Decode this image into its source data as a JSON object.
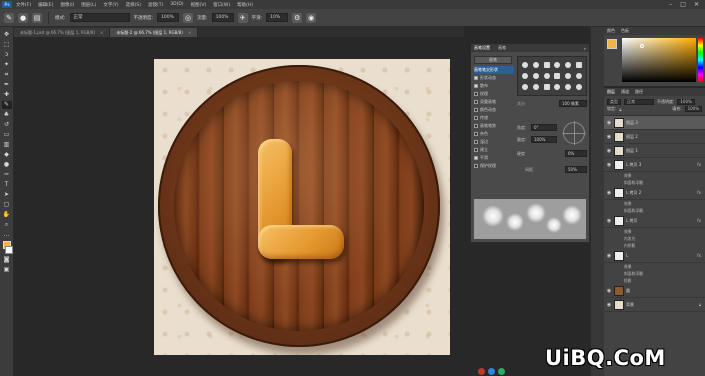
{
  "menubar": {
    "logo": "Ps",
    "items": [
      "文件(F)",
      "编辑(E)",
      "图像(I)",
      "图层(L)",
      "文字(Y)",
      "选择(S)",
      "滤镜(T)",
      "3D(D)",
      "视图(V)",
      "窗口(W)",
      "帮助(H)"
    ],
    "window_buttons": [
      "–",
      "□",
      "✕"
    ]
  },
  "options": {
    "mode_label": "模式:",
    "mode_value": "正常",
    "opacity_label": "不透明度:",
    "opacity_value": "100%",
    "flow_label": "流量:",
    "flow_value": "100%",
    "smooth_label": "平滑:",
    "smooth_value": "10%"
  },
  "tabs": [
    {
      "label": "未标题-1.psd @ 66.7% (图层 1, RGB/8)",
      "close": "×"
    },
    {
      "label": "未标题-2 @ 66.7% (图层 1, RGB/8)",
      "close": "×"
    }
  ],
  "brush_panel": {
    "tab1": "画笔设置",
    "tab2": "画笔",
    "close": "»",
    "presets_button": "画笔",
    "options": [
      {
        "label": "画笔笔尖形状",
        "on": false
      },
      {
        "label": "形状动态",
        "on": true
      },
      {
        "label": "散布",
        "on": true
      },
      {
        "label": "纹理",
        "on": false
      },
      {
        "label": "双重画笔",
        "on": false
      },
      {
        "label": "颜色动态",
        "on": false
      },
      {
        "label": "传递",
        "on": false
      },
      {
        "label": "画笔笔势",
        "on": false
      },
      {
        "label": "杂色",
        "on": false
      },
      {
        "label": "湿边",
        "on": false
      },
      {
        "label": "建立",
        "on": false
      },
      {
        "label": "平滑",
        "on": true
      },
      {
        "label": "保护纹理",
        "on": false
      }
    ],
    "size_label": "大小",
    "size_value": "100 像素",
    "angle_label": "角度:",
    "angle_value": "0°",
    "roundness_label": "圆度:",
    "roundness_value": "100%",
    "hardness_label": "硬度",
    "hardness_value": "0%",
    "spacing_label": "间距",
    "spacing_value": "50%"
  },
  "color_panel": {
    "tab1": "颜色",
    "tab2": "色板",
    "fg_color": "#f0b449",
    "bg_color": "#ffffff"
  },
  "layers_panel": {
    "tab1": "图层",
    "tab2": "通道",
    "tab3": "路径",
    "filter_label": "类型",
    "blend_mode": "正常",
    "opacity_label": "不透明度:",
    "opacity_value": "100%",
    "lock_label": "锁定:",
    "fill_label": "填充:",
    "fill_value": "100%",
    "layers": [
      {
        "name": "图层 3",
        "selected": true
      },
      {
        "name": "图层 2",
        "selected": false
      },
      {
        "name": "图层 1",
        "selected": false
      },
      {
        "name": "L 拷贝 3",
        "selected": false,
        "fx": "fx",
        "effects": [
          "效果",
          "斜面和浮雕"
        ]
      },
      {
        "name": "L 拷贝 2",
        "selected": false,
        "fx": "fx",
        "effects": [
          "效果",
          "斜面和浮雕"
        ]
      },
      {
        "name": "L 拷贝",
        "selected": false,
        "fx": "fx",
        "effects": [
          "效果",
          "内发光",
          "内阴影"
        ]
      },
      {
        "name": "L",
        "selected": false,
        "fx": "fx",
        "effects": [
          "效果",
          "斜面和浮雕",
          "投影"
        ]
      },
      {
        "name": "圆",
        "selected": false
      },
      {
        "name": "背景",
        "selected": false
      }
    ]
  },
  "watermark": "UiBQ.CoM"
}
